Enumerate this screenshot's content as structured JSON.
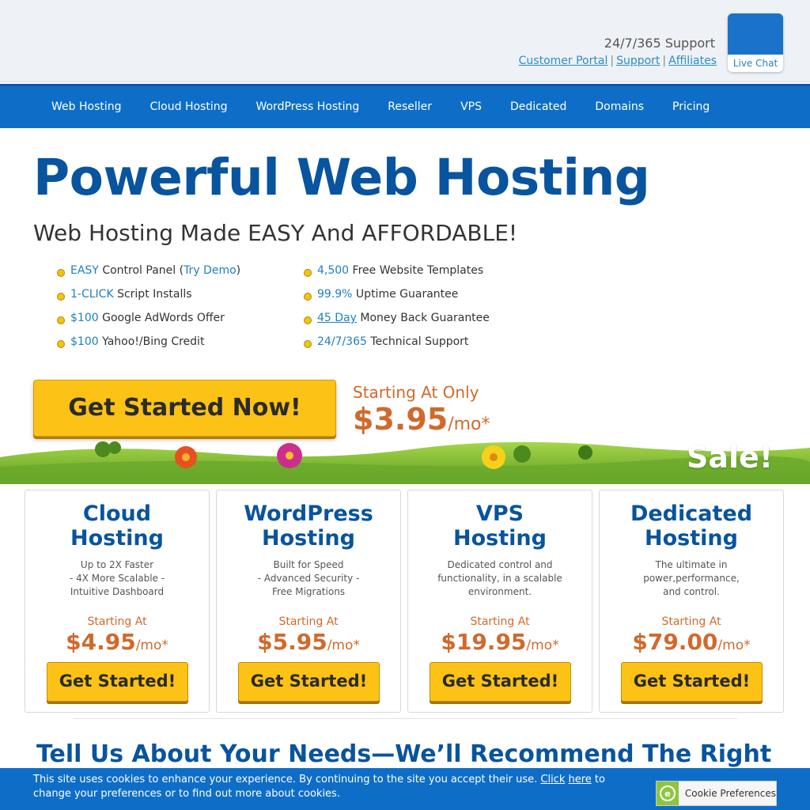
{
  "header": {
    "support_title": "24/7/365 Support",
    "links": [
      "Customer Portal",
      "Support",
      "Affiliates"
    ],
    "live_chat": "Live Chat"
  },
  "nav": {
    "items": [
      "Web Hosting",
      "Cloud Hosting",
      "WordPress Hosting",
      "Reseller",
      "VPS",
      "Dedicated",
      "Domains",
      "Pricing"
    ]
  },
  "hero": {
    "title": "Powerful Web Hosting",
    "subtitle": "Web Hosting Made EASY And AFFORDABLE!",
    "features_col1": [
      {
        "hl": "EASY",
        "text": " Control Panel (",
        "hl2": "Try Demo",
        "tail": ")"
      },
      {
        "hl": "1-CLICK",
        "text": " Script Installs"
      },
      {
        "hl": "$100",
        "text": " Google AdWords Offer"
      },
      {
        "hl": "$100",
        "text": " Yahoo!/Bing Credit"
      }
    ],
    "features_col2": [
      {
        "hl": "4,500",
        "text": " Free Website Templates"
      },
      {
        "hl": "99.9%",
        "text": " Uptime Guarantee"
      },
      {
        "hl": "45 Day",
        "text": " Money Back Guarantee"
      },
      {
        "hl": "24/7/365",
        "text": " Technical Support"
      }
    ],
    "cta": "Get Started Now!",
    "starting_label": "Starting At Only",
    "price": "$3.95",
    "per": "/mo*",
    "sale": "Sale!"
  },
  "cards": [
    {
      "title1": "Cloud",
      "title2": "Hosting",
      "desc": [
        "Up to 2X Faster",
        "- 4X More Scalable -",
        "Intuitive Dashboard"
      ],
      "starting": "Starting At",
      "price": "$4.95",
      "per": "/mo*",
      "button": "Get Started!"
    },
    {
      "title1": "WordPress",
      "title2": "Hosting",
      "desc": [
        "Built for Speed",
        "- Advanced Security -",
        "Free Migrations"
      ],
      "starting": "Starting At",
      "price": "$5.95",
      "per": "/mo*",
      "button": "Get Started!"
    },
    {
      "title1": "VPS",
      "title2": "Hosting",
      "desc": [
        "Dedicated control and",
        "functionality, in a scalable",
        "environment."
      ],
      "starting": "Starting At",
      "price": "$19.95",
      "per": "/mo*",
      "button": "Get Started!"
    },
    {
      "title1": "Dedicated",
      "title2": "Hosting",
      "desc": [
        "The ultimate in",
        "power,performance,",
        "and control."
      ],
      "starting": "Starting At",
      "price": "$79.00",
      "per": "/mo*",
      "button": "Get Started!"
    }
  ],
  "section_heading": "Tell Us About Your Needs—We’ll Recommend The Right",
  "cookie": {
    "text_before": "This site uses cookies to enhance your experience. By continuing to the site you accept their use. ",
    "link1": "Click",
    "link2": "here",
    "text_after": " to change your preferences or to find out more about cookies.",
    "button": "Cookie Preferences"
  },
  "colors": {
    "brand_blue": "#08549e",
    "nav_blue": "#0e6ec7",
    "cta_yellow": "#fdc216",
    "price_orange": "#d2692b"
  }
}
